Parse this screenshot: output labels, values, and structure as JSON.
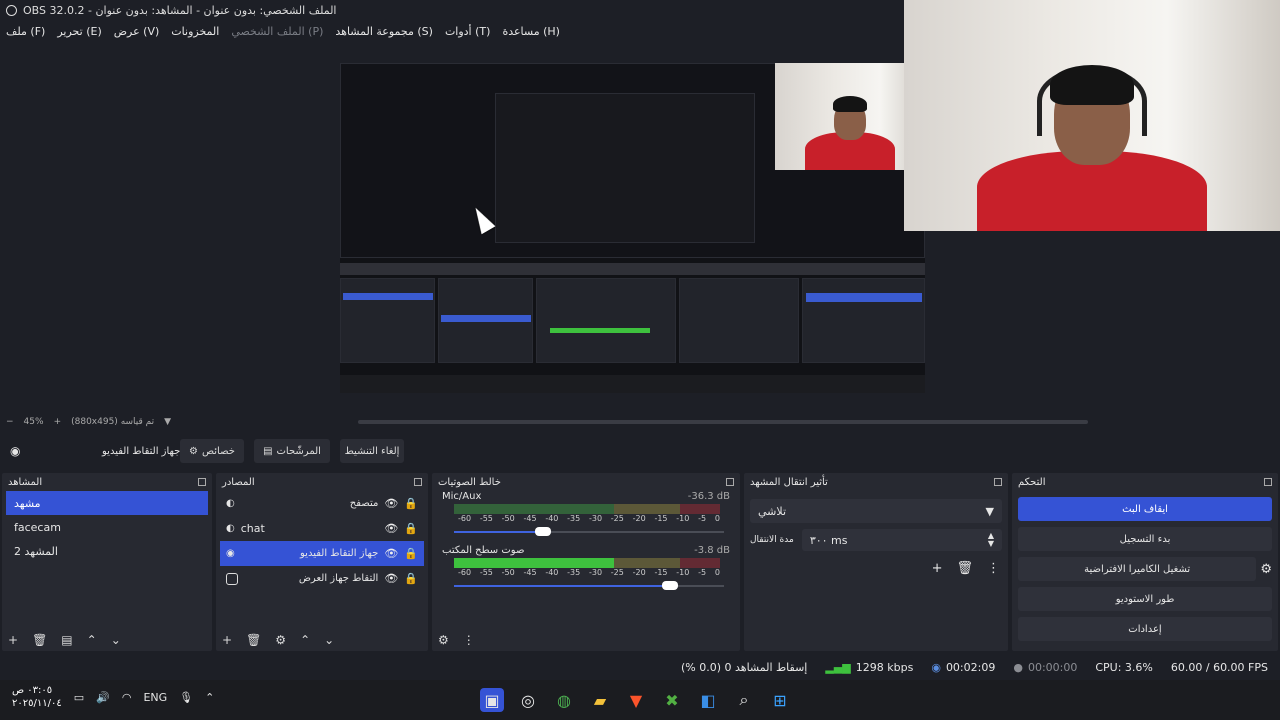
{
  "window": {
    "title": "OBS 32.0.2 - الملف الشخصي: بدون عنوان - المشاهد: بدون عنوان"
  },
  "menu": {
    "file": "ملف (F)",
    "edit": "تحرير (E)",
    "view": "عرض (V)",
    "docks": "المخزونات",
    "profile": "الملف الشخصي (P)",
    "scene_collection": "مجموعة المشاهد (S)",
    "tools": "أدوات (T)",
    "help": "مساعدة (H)"
  },
  "zoom": {
    "percent": "45%",
    "resolution": "(880x495) تم قياسه"
  },
  "toolbar": {
    "source_name": "جهاز التقاط الفيديو",
    "properties": "خصائص",
    "filters": "المرشّحات",
    "deactivate": "إلغاء التنشيط"
  },
  "scenes": {
    "title": "المشاهد",
    "items": [
      "مشهد",
      "facecam",
      "المشهد 2"
    ],
    "selected": 0
  },
  "sources": {
    "title": "المصادر",
    "items": [
      {
        "name": "متصفح",
        "icon": "globe-icon"
      },
      {
        "name": "chat",
        "icon": "globe-icon"
      },
      {
        "name": "جهاز التقاط الفيديو",
        "icon": "camera-icon"
      },
      {
        "name": "التقاط جهاز العرض",
        "icon": "monitor-icon"
      }
    ],
    "selected": 2
  },
  "mixer": {
    "title": "خالط الصوتيات",
    "channels": [
      {
        "name": "Mic/Aux",
        "db": "-36.3 dB",
        "level": 0.0,
        "volume": 0.33
      },
      {
        "name": "صوت سطح المكتب",
        "db": "-3.8 dB",
        "level": 0.35,
        "volume": 0.8
      }
    ],
    "ticks": [
      "-60",
      "-55",
      "-50",
      "-45",
      "-40",
      "-35",
      "-30",
      "-25",
      "-20",
      "-15",
      "-10",
      "-5",
      "0"
    ]
  },
  "transitions": {
    "title": "تأثير انتقال المشهد",
    "type": "تلاشي",
    "duration_label": "مدة الانتقال",
    "duration": "٣٠٠ ms"
  },
  "controls": {
    "title": "التحكم",
    "stop_stream": "ايقاف البث",
    "start_recording": "بدء التسجيل",
    "virtual_camera": "تشغيل الكاميرا الافتراضية",
    "studio_mode": "طور الاستوديو",
    "settings": "إعدادات"
  },
  "status": {
    "dropped": "إسقاط المشاهد 0 (0.0 %)",
    "bitrate": "1298 kbps",
    "stream_time": "00:02:09",
    "record_time": "00:00:00",
    "cpu": "CPU: 3.6%",
    "fps": "60.00 / 60.00 FPS"
  },
  "taskbar": {
    "time": "٠٣:٠٥ ص",
    "date": "٢٠٢٥/١١/٠٤",
    "lang": "ENG"
  },
  "colors": {
    "accent": "#3553d5",
    "panel": "#272931",
    "bg": "#1d1f26",
    "meter_green": "#3ec13e",
    "meter_yellow": "#b5a23a",
    "meter_red": "#c8202a"
  }
}
